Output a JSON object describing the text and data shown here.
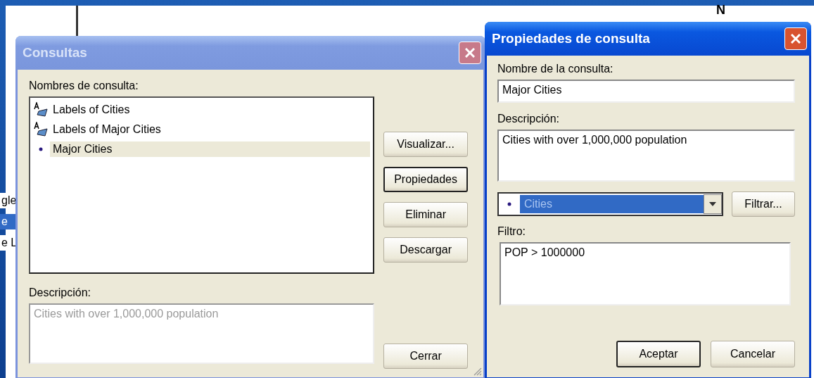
{
  "background": {
    "north_label": "N",
    "list_fragments": [
      {
        "label": "gle",
        "selected": false
      },
      {
        "label": "e",
        "selected": true
      },
      {
        "label": "e L",
        "selected": false
      }
    ]
  },
  "query_list_dialog": {
    "title": "Consultas",
    "active": false,
    "list_label": "Nombres de consulta:",
    "queries": [
      {
        "name": "Labels of Cities",
        "kind": "label",
        "selected": false
      },
      {
        "name": "Labels of Major Cities",
        "kind": "label",
        "selected": false
      },
      {
        "name": "Major Cities",
        "kind": "point",
        "selected": true
      }
    ],
    "buttons": [
      {
        "label": "Visualizar...",
        "default": false
      },
      {
        "label": "Propiedades",
        "default": true
      },
      {
        "label": "Eliminar",
        "default": false
      },
      {
        "label": "Descargar",
        "default": false
      }
    ],
    "description_label": "Descripción:",
    "description": "Cities with over 1,000,000 population",
    "close_button": "Cerrar"
  },
  "properties_dialog": {
    "title": "Propiedades de consulta",
    "active": true,
    "name_label": "Nombre de la consulta:",
    "name": "Major Cities",
    "description_label": "Descripción:",
    "description": "Cities with over 1,000,000 population",
    "layer_combo": {
      "value": "Cities",
      "focused": true
    },
    "filter_button": "Filtrar...",
    "filter_label": "Filtro:",
    "filter": "POP > 1000000",
    "buttons": [
      {
        "label": "Aceptar",
        "default": true
      },
      {
        "label": "Cancelar",
        "default": false
      }
    ]
  }
}
